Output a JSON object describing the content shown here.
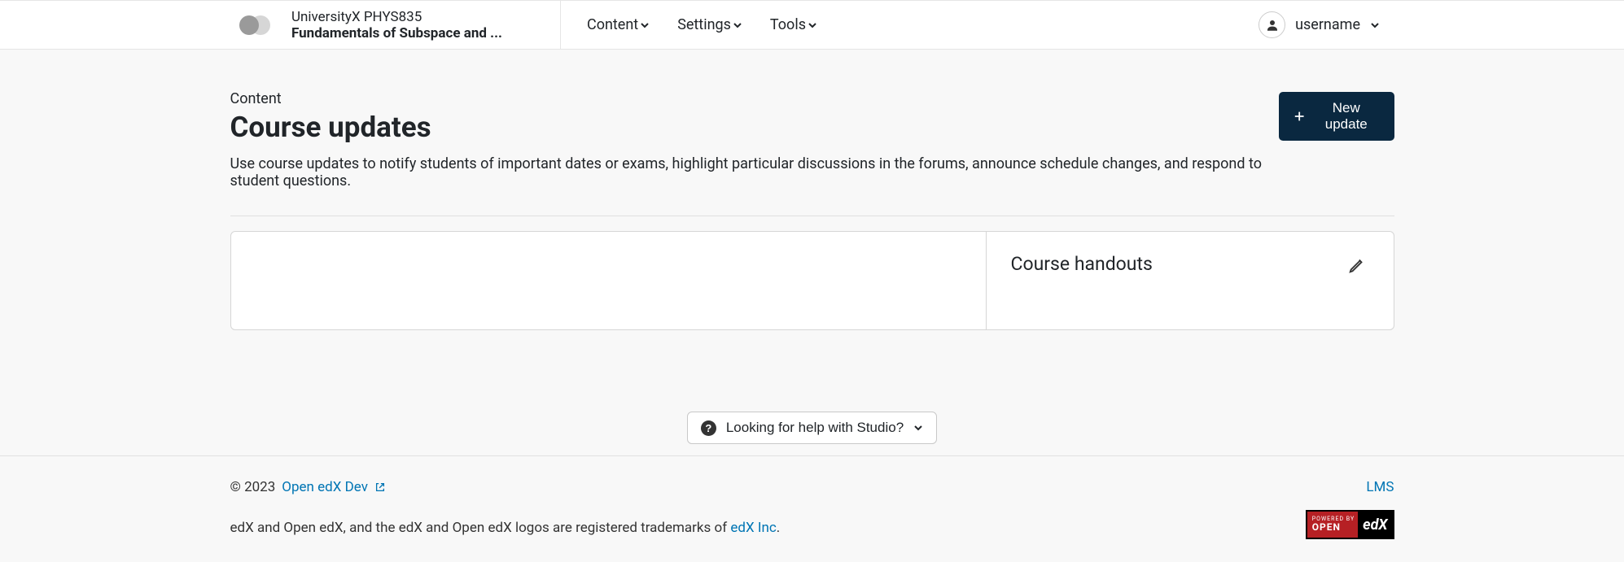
{
  "header": {
    "course_code": "UniversityX PHYS835",
    "course_name": "Fundamentals of Subspace and ...",
    "nav": {
      "content": "Content",
      "settings": "Settings",
      "tools": "Tools"
    },
    "username": "username"
  },
  "page": {
    "breadcrumb": "Content",
    "title": "Course updates",
    "description": "Use course updates to notify students of important dates or exams, highlight particular discussions in the forums, announce schedule changes, and respond to student questions.",
    "new_update_label": "New update",
    "handouts_title": "Course handouts"
  },
  "help": {
    "label": "Looking for help with Studio?"
  },
  "footer": {
    "copyright": "© 2023",
    "open_edx_dev": "Open edX Dev",
    "trademark_prefix": "edX and Open edX, and the edX and Open edX logos are registered trademarks of ",
    "edx_inc": "edX Inc",
    "period": ".",
    "lms": "LMS",
    "powered_by": "POWERED BY",
    "open_label": "OPEN",
    "edx_label": "edX"
  }
}
